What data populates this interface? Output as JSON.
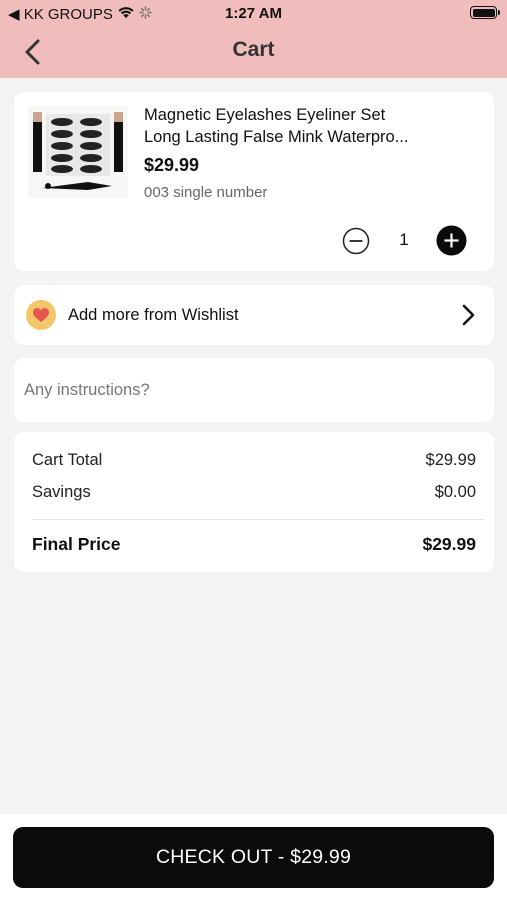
{
  "status_bar": {
    "carrier": "◀ KK GROUPS",
    "time": "1:27 AM"
  },
  "header": {
    "title": "Cart",
    "background_color": "#f0bdbc"
  },
  "cart_item": {
    "title_line1": "Magnetic Eyelashes Eyeliner Set",
    "title_line2": "Long Lasting False Mink Waterpro...",
    "price": "$29.99",
    "variant": "003 single number",
    "quantity": "1",
    "thumbnail_icon": "eyelash-set-image"
  },
  "wishlist": {
    "label": "Add more from Wishlist",
    "icon": "heart-icon",
    "badge_color": "#f3c66a"
  },
  "instructions": {
    "placeholder": "Any instructions?",
    "value": ""
  },
  "summary": {
    "cart_total_label": "Cart Total",
    "cart_total_value": "$29.99",
    "savings_label": "Savings",
    "savings_value": "$0.00",
    "final_price_label": "Final Price",
    "final_price_value": "$29.99"
  },
  "checkout": {
    "label": "CHECK OUT - $29.99"
  }
}
